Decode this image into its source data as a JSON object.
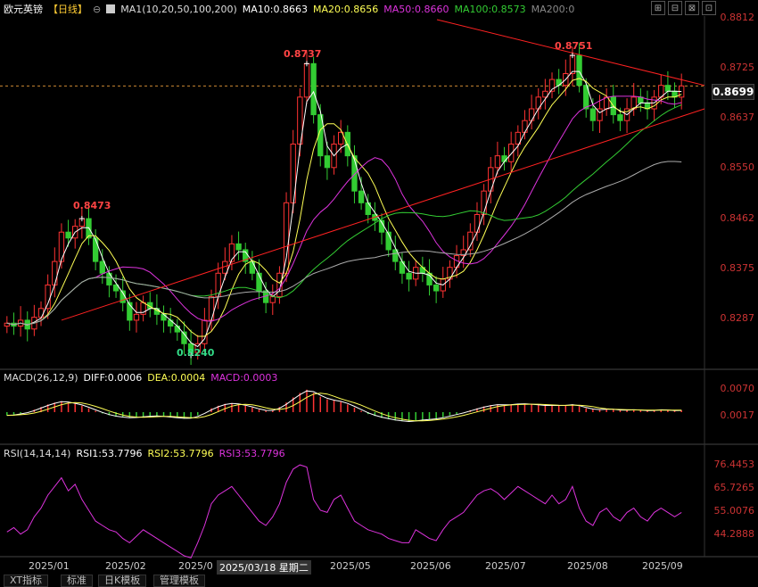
{
  "header": {
    "symbol": "欧元英镑",
    "period": "【日线】",
    "ma_header": "MA1(10,20,50,100,200)",
    "ma10": "MA10:0.8663",
    "ma20": "MA20:0.8656",
    "ma50": "MA50:0.8660",
    "ma100": "MA100:0.8573",
    "ma200": "MA200:0",
    "win_buttons": [
      "⊞",
      "⊟",
      "⊠",
      "⊡"
    ]
  },
  "colors": {
    "up": "#ff3333",
    "down": "#33cc33",
    "ma10": "#ffffff",
    "ma20": "#ffff55",
    "ma50": "#dd33dd",
    "ma100": "#33cc33",
    "ma200": "#aaaaaa",
    "trendline": "#ff2222",
    "price_label": "#ff4444",
    "low_label": "#33dd88",
    "rsi1": "#ffffff",
    "rsi2": "#ffff55",
    "rsi3": "#dd33dd"
  },
  "macd": {
    "title": "MACD(26,12,9)",
    "diff": "DIFF:0.0006",
    "dea": "DEA:0.0004",
    "macd": "MACD:0.0003"
  },
  "rsi": {
    "title": "RSI(14,14,14)",
    "rsi1": "RSI1:53.7796",
    "rsi2": "RSI2:53.7796",
    "rsi3": "RSI3:53.7796"
  },
  "axis": {
    "price_ticks": [
      "0.8812",
      "0.8725",
      "0.8637",
      "0.8550",
      "0.8462",
      "0.8375",
      "0.8287"
    ],
    "current_price": "0.8699",
    "macd_ticks": [
      "0.0070",
      "0.0017"
    ],
    "rsi_ticks": [
      "76.4453",
      "65.7265",
      "55.0076",
      "44.2888"
    ],
    "dates": [
      "2025/01",
      "2025/02",
      "2025/0",
      "2025/03/18 星期二",
      "2025/05",
      "2025/06",
      "2025/07",
      "2025/08",
      "2025/09"
    ]
  },
  "annotations": {
    "high1": "0.8473",
    "low1": "0.8240",
    "high2": "0.8737",
    "high3": "0.8751"
  },
  "tabs": [
    "XT指标",
    "标准",
    "日K模板",
    "管理模板"
  ],
  "chart_data": {
    "type": "line",
    "title": "欧元英镑【日线】",
    "price_range": [
      0.824,
      0.8812
    ],
    "close_series": [
      0.8295,
      0.829,
      0.83,
      0.8285,
      0.8305,
      0.832,
      0.836,
      0.84,
      0.845,
      0.844,
      0.846,
      0.8473,
      0.844,
      0.84,
      0.838,
      0.836,
      0.835,
      0.833,
      0.83,
      0.831,
      0.833,
      0.832,
      0.831,
      0.83,
      0.829,
      0.828,
      0.826,
      0.8245,
      0.826,
      0.83,
      0.834,
      0.838,
      0.84,
      0.843,
      0.842,
      0.84,
      0.838,
      0.835,
      0.833,
      0.834,
      0.838,
      0.85,
      0.86,
      0.868,
      0.8737,
      0.865,
      0.858,
      0.856,
      0.86,
      0.862,
      0.858,
      0.852,
      0.85,
      0.848,
      0.847,
      0.845,
      0.842,
      0.84,
      0.838,
      0.837,
      0.839,
      0.838,
      0.836,
      0.835,
      0.837,
      0.839,
      0.841,
      0.842,
      0.845,
      0.848,
      0.852,
      0.856,
      0.858,
      0.857,
      0.86,
      0.862,
      0.864,
      0.866,
      0.868,
      0.869,
      0.871,
      0.87,
      0.872,
      0.8751,
      0.87,
      0.866,
      0.864,
      0.866,
      0.868,
      0.865,
      0.864,
      0.866,
      0.868,
      0.867,
      0.866,
      0.868,
      0.87,
      0.869,
      0.868,
      0.8699
    ],
    "ma_values": {
      "MA10": 0.8663,
      "MA20": 0.8656,
      "MA50": 0.866,
      "MA100": 0.8573,
      "MA200": 0
    },
    "macd_values": {
      "DIFF": 0.0006,
      "DEA": 0.0004,
      "MACD": 0.0003
    },
    "rsi_values": {
      "RSI1": 53.7796,
      "RSI2": 53.7796,
      "RSI3": 53.7796
    },
    "rsi_series": [
      45,
      47,
      44,
      46,
      52,
      56,
      62,
      66,
      70,
      64,
      67,
      60,
      55,
      50,
      48,
      46,
      45,
      42,
      40,
      43,
      46,
      44,
      42,
      40,
      38,
      36,
      34,
      33,
      40,
      48,
      58,
      62,
      64,
      66,
      62,
      58,
      54,
      50,
      48,
      52,
      58,
      68,
      74,
      76,
      75,
      60,
      55,
      54,
      60,
      62,
      56,
      50,
      48,
      46,
      45,
      44,
      42,
      41,
      40,
      40,
      46,
      44,
      42,
      41,
      46,
      50,
      52,
      54,
      58,
      62,
      64,
      65,
      63,
      60,
      63,
      66,
      64,
      62,
      60,
      58,
      62,
      58,
      60,
      66,
      56,
      50,
      48,
      54,
      56,
      52,
      50,
      54,
      56,
      52,
      50,
      54,
      56,
      54,
      52,
      54
    ],
    "macd_series": [
      -0.001,
      -0.0008,
      -0.0004,
      0.0,
      0.0008,
      0.0016,
      0.0024,
      0.003,
      0.0034,
      0.003,
      0.0026,
      0.002,
      0.0012,
      0.0004,
      -0.0004,
      -0.001,
      -0.0014,
      -0.0016,
      -0.0018,
      -0.0016,
      -0.0014,
      -0.0012,
      -0.0012,
      -0.0014,
      -0.0016,
      -0.0018,
      -0.002,
      -0.0018,
      -0.001,
      0.0,
      0.0012,
      0.002,
      0.0026,
      0.0028,
      0.0024,
      0.002,
      0.0014,
      0.0008,
      0.0004,
      0.0006,
      0.0016,
      0.003,
      0.0046,
      0.006,
      0.007,
      0.006,
      0.0048,
      0.004,
      0.0036,
      0.0032,
      0.0024,
      0.0014,
      0.0004,
      -0.0006,
      -0.0012,
      -0.0018,
      -0.0022,
      -0.0026,
      -0.0028,
      -0.003,
      -0.0026,
      -0.0024,
      -0.0022,
      -0.002,
      -0.0016,
      -0.001,
      -0.0006,
      0.0,
      0.0006,
      0.0012,
      0.0018,
      0.0022,
      0.0024,
      0.0022,
      0.0024,
      0.0026,
      0.0026,
      0.0024,
      0.0022,
      0.002,
      0.0022,
      0.002,
      0.0022,
      0.0024,
      0.0018,
      0.0012,
      0.0008,
      0.0008,
      0.001,
      0.0008,
      0.0006,
      0.0006,
      0.0008,
      0.0006,
      0.0004,
      0.0006,
      0.0008,
      0.0006,
      0.0004,
      0.0006
    ]
  }
}
